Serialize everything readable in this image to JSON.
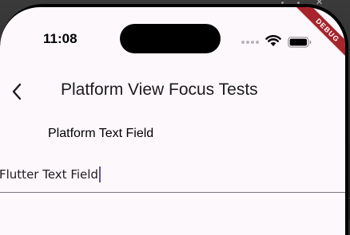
{
  "status_bar": {
    "time": "11:08"
  },
  "debug_banner": {
    "label": "DEBUG"
  },
  "app_bar": {
    "back_icon": "chevron-left-icon",
    "title": "Platform View Focus Tests"
  },
  "platform_text_field": {
    "label": "Platform Text Field"
  },
  "flutter_text_field": {
    "value": "Flutter Text Field",
    "focused": true,
    "underline_color": "#7a757f",
    "cursor_color": "#65558f"
  },
  "colors": {
    "screen_background": "#fdf8fc",
    "debug_ribbon": "#a6242a"
  }
}
